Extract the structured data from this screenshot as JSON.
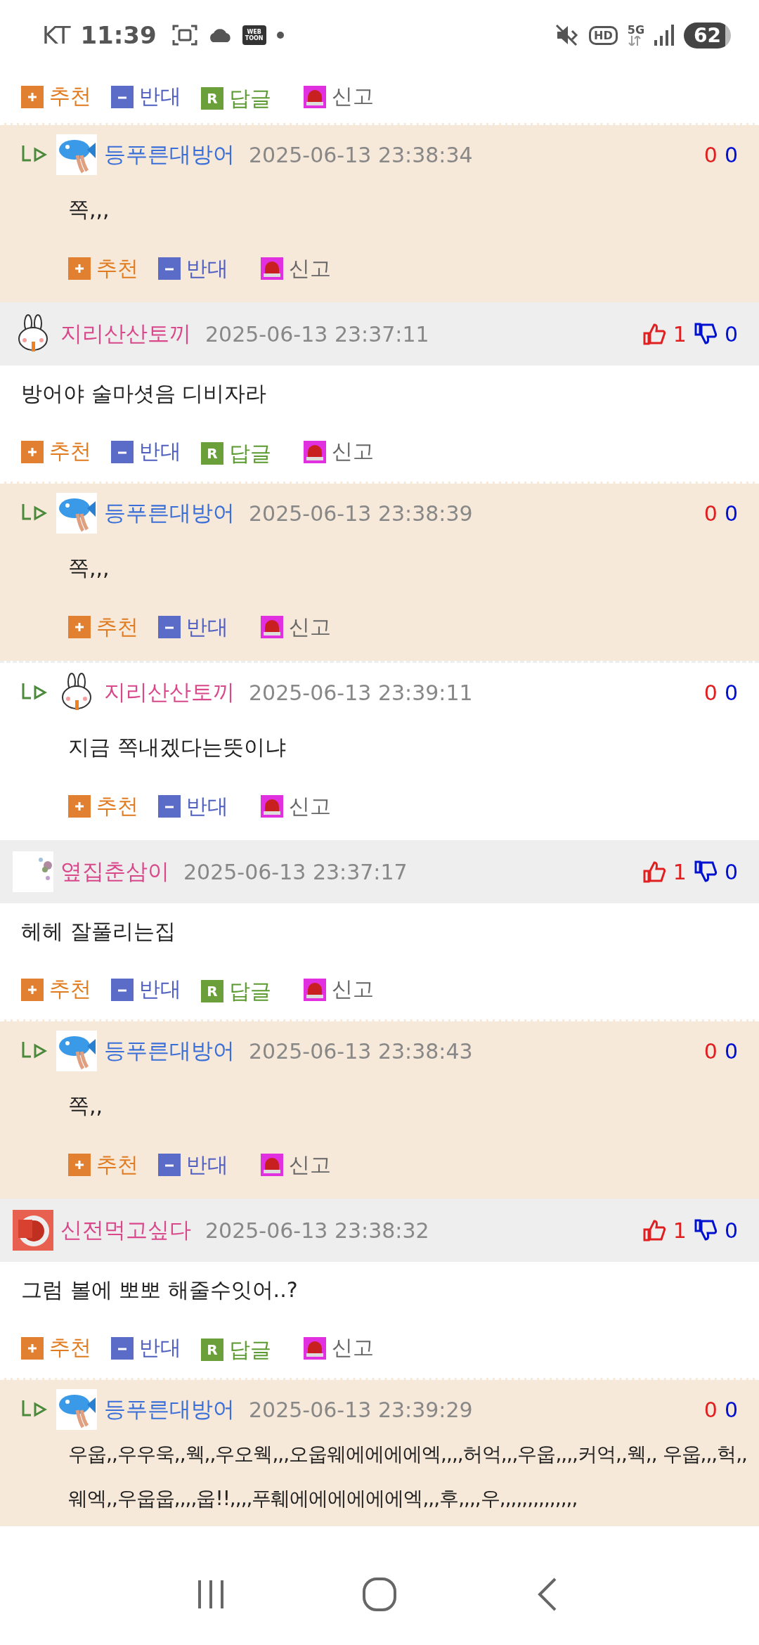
{
  "status_bar": {
    "carrier": "KT",
    "time": "11:39",
    "webtoon": "WEB TOON",
    "hd": "HD",
    "network": "5G",
    "battery": "62"
  },
  "entries": [
    {
      "kind": "actions_only",
      "actions": [
        {
          "kind": "up",
          "label": "추천"
        },
        {
          "kind": "down",
          "label": "반대"
        },
        {
          "kind": "reply",
          "label": "답글",
          "glyph": "R"
        },
        {
          "kind": "report",
          "label": "신고"
        }
      ]
    },
    {
      "kind": "reply",
      "highlighted": true,
      "avatar": {
        "kind": "fish"
      },
      "author": "등푸른대방어",
      "color": "#3a6fd8",
      "timestamp": "2025-06-13 23:38:34",
      "likes": "0",
      "dislikes": "0",
      "body": "쪽,,,",
      "actions": [
        {
          "kind": "up",
          "label": "추천"
        },
        {
          "kind": "down",
          "label": "반대"
        },
        {
          "kind": "report",
          "label": "신고"
        }
      ]
    },
    {
      "kind": "comment",
      "avatar": {
        "kind": "rabbit"
      },
      "author": "지리산산토끼",
      "color": "#d9488a",
      "timestamp": "2025-06-13 23:37:11",
      "likes": "1",
      "dislikes": "0",
      "body": "방어야 술마셧음 디비자라",
      "actions": [
        {
          "kind": "up",
          "label": "추천"
        },
        {
          "kind": "down",
          "label": "반대"
        },
        {
          "kind": "reply",
          "label": "답글",
          "glyph": "R"
        },
        {
          "kind": "report",
          "label": "신고"
        }
      ]
    },
    {
      "kind": "reply",
      "highlighted": true,
      "avatar": {
        "kind": "fish"
      },
      "author": "등푸른대방어",
      "color": "#3a6fd8",
      "timestamp": "2025-06-13 23:38:39",
      "likes": "0",
      "dislikes": "0",
      "body": "쪽,,,",
      "actions": [
        {
          "kind": "up",
          "label": "추천"
        },
        {
          "kind": "down",
          "label": "반대"
        },
        {
          "kind": "report",
          "label": "신고"
        }
      ]
    },
    {
      "kind": "reply",
      "highlighted": false,
      "avatar": {
        "kind": "rabbit"
      },
      "author": "지리산산토끼",
      "color": "#d9488a",
      "timestamp": "2025-06-13 23:39:11",
      "likes": "0",
      "dislikes": "0",
      "body": "지금 쪽내겠다는뜻이냐",
      "actions": [
        {
          "kind": "up",
          "label": "추천"
        },
        {
          "kind": "down",
          "label": "반대"
        },
        {
          "kind": "report",
          "label": "신고"
        }
      ]
    },
    {
      "kind": "comment",
      "avatar": {
        "kind": "flowers"
      },
      "author": "옆집춘삼이",
      "color": "#d9488a",
      "timestamp": "2025-06-13 23:37:17",
      "likes": "1",
      "dislikes": "0",
      "body": "헤헤 잘풀리는집",
      "actions": [
        {
          "kind": "up",
          "label": "추천"
        },
        {
          "kind": "down",
          "label": "반대"
        },
        {
          "kind": "reply",
          "label": "답글",
          "glyph": "R"
        },
        {
          "kind": "report",
          "label": "신고"
        }
      ]
    },
    {
      "kind": "reply",
      "highlighted": true,
      "avatar": {
        "kind": "fish"
      },
      "author": "등푸른대방어",
      "color": "#3a6fd8",
      "timestamp": "2025-06-13 23:38:43",
      "likes": "0",
      "dislikes": "0",
      "body": "쪽,,",
      "actions": [
        {
          "kind": "up",
          "label": "추천"
        },
        {
          "kind": "down",
          "label": "반대"
        },
        {
          "kind": "report",
          "label": "신고"
        }
      ]
    },
    {
      "kind": "comment",
      "avatar": {
        "kind": "badge"
      },
      "author": "신전먹고싶다",
      "color": "#d9488a",
      "timestamp": "2025-06-13 23:38:32",
      "likes": "1",
      "dislikes": "0",
      "body": "그럼 볼에 뽀뽀 해줄수잇어..?",
      "actions": [
        {
          "kind": "up",
          "label": "추천"
        },
        {
          "kind": "down",
          "label": "반대"
        },
        {
          "kind": "reply",
          "label": "답글",
          "glyph": "R"
        },
        {
          "kind": "report",
          "label": "신고"
        }
      ]
    },
    {
      "kind": "reply",
      "highlighted": true,
      "avatar": {
        "kind": "fish"
      },
      "author": "등푸른대방어",
      "color": "#3a6fd8",
      "timestamp": "2025-06-13 23:39:29",
      "likes": "0",
      "dislikes": "0",
      "body": "우웁,,우우욱,,웩,,우오웩,,,오웁웨에에에에엑,,,,허억,,,우웁,,,,커억,,웩,, 우웁,,,헉,,웨엑,,우웁웁,,,,웁!!,,,,푸훼에에에에에에엑,,,후,,,,우,,,,,,,,,,,,,,"
    }
  ]
}
